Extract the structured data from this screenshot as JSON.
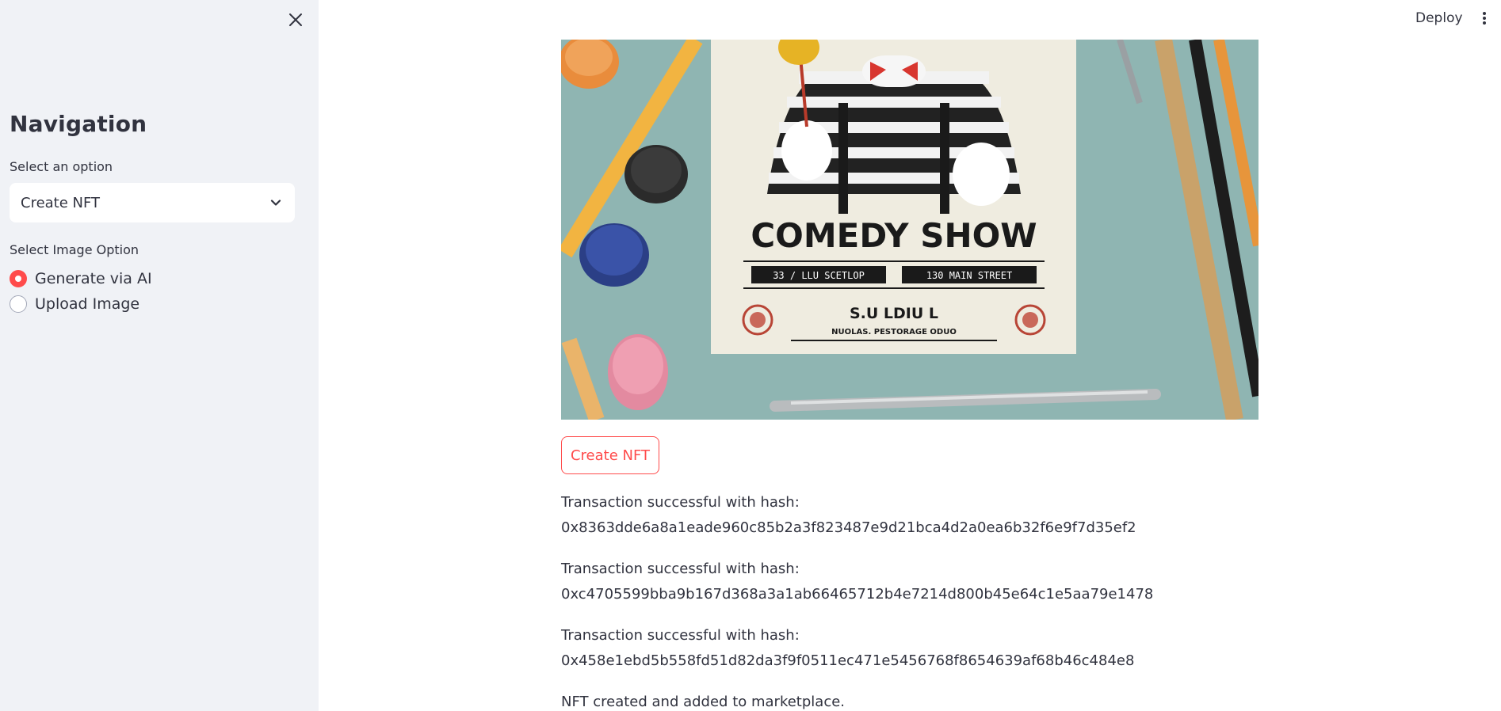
{
  "sidebar": {
    "title": "Navigation",
    "select_label": "Select an option",
    "select_value": "Create NFT",
    "radio_label": "Select Image Option",
    "radio_options": [
      "Generate via AI",
      "Upload Image"
    ],
    "radio_selected": "Generate via AI"
  },
  "header": {
    "deploy_label": "Deploy"
  },
  "main": {
    "poster": {
      "headline": "COMEDY SHOW",
      "banner_left": "33 / LLU SCETLOP",
      "banner_right": "130 MAIN STREET",
      "subline": "S.U LDIU L",
      "footer": "NUOLAS. PESTORAGE ODUO"
    },
    "create_button": "Create NFT",
    "messages": [
      {
        "label": "Transaction successful with hash:",
        "hash": "0x8363dde6a8a1eade960c85b2a3f823487e9d21bca4d2a0ea6b32f6e9f7d35ef2"
      },
      {
        "label": "Transaction successful with hash:",
        "hash": "0xc4705599bba9b167d368a3a1ab66465712b4e7214d800b45e64c1e5aa79e1478"
      },
      {
        "label": "Transaction successful with hash:",
        "hash": "0x458e1ebd5b558fd51d82da3f9f0511ec471e5456768f8654639af68b46c484e8"
      }
    ],
    "final_message": "NFT created and added to marketplace."
  },
  "colors": {
    "accent": "#ff4b4b",
    "sidebar_bg": "#f0f2f6",
    "text": "#31333f"
  }
}
